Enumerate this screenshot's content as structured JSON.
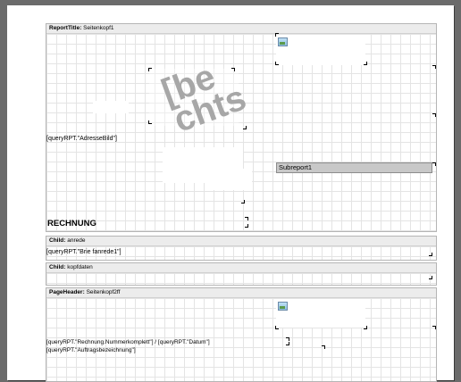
{
  "bands": {
    "report_title": {
      "type": "ReportTitle:",
      "name": "Seitenkopf1"
    },
    "child1": {
      "type": "Child:",
      "name": "anrede"
    },
    "child2": {
      "type": "Child:",
      "name": "kopfdaten"
    },
    "page_header": {
      "type": "PageHeader:",
      "name": "Seitenkopf2ff"
    }
  },
  "fields": {
    "adresse_bild": "[queryRPT.\"AdresseBild\"]",
    "rechnung": "RECHNUNG",
    "briefanrede": "[queryRPT.\"Brie fanrede1\"]",
    "nummer_datum": "[queryRPT.\"Rechnung.Nummerkomplett\"] / [queryRPT.\"Datum\"]",
    "auftragsbezeichnung": "[queryRPT.\"Auftragsbezeichnung\"]"
  },
  "subreport": {
    "label": "Subreport1"
  },
  "watermark": {
    "line1": "[be",
    "line2": "chts"
  },
  "colors": {
    "background": "#6b6b6b",
    "page": "#ffffff",
    "grid": "#e4e4e4",
    "band_header": "#ececec",
    "subreport": "#c8c8c8",
    "watermark": "#a7a7a7"
  },
  "icons": [
    "picture-icon"
  ]
}
